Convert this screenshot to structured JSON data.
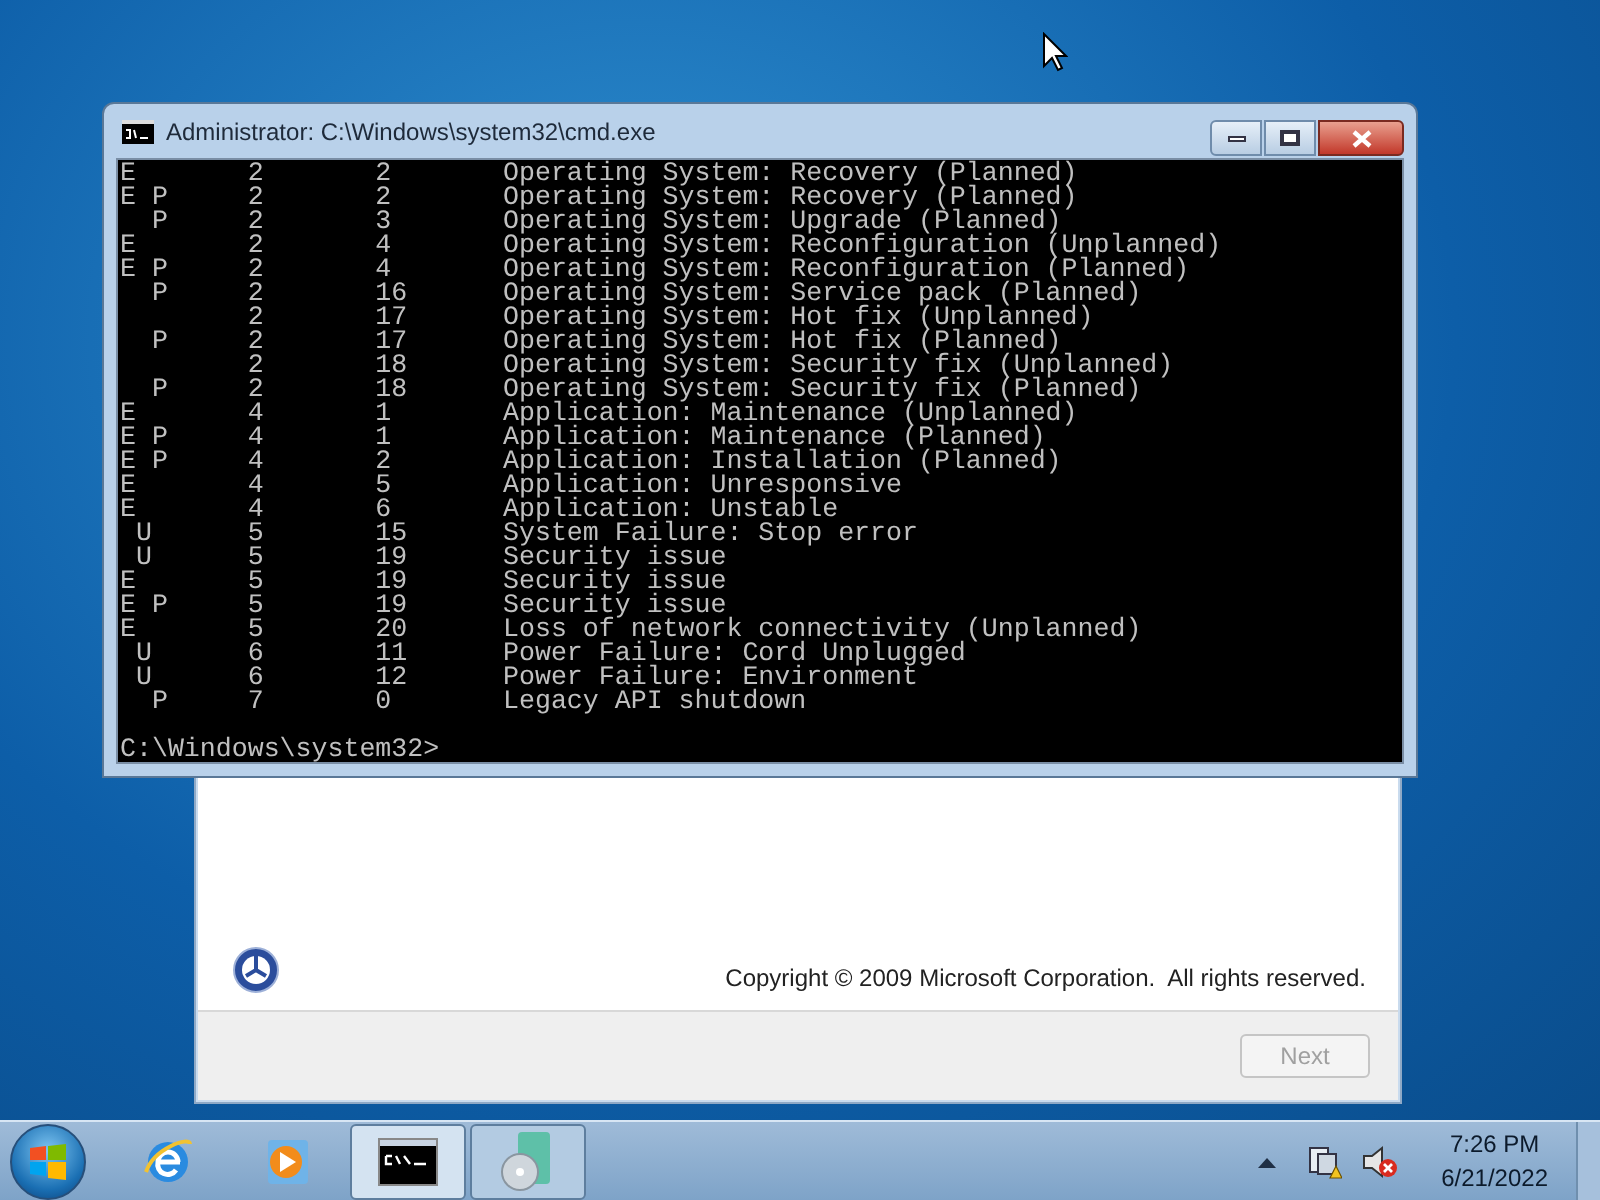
{
  "console": {
    "title": "Administrator: C:\\Windows\\system32\\cmd.exe",
    "lines": [
      "E       2       2       Operating System: Recovery (Planned)",
      "E P     2       2       Operating System: Recovery (Planned)",
      "  P     2       3       Operating System: Upgrade (Planned)",
      "E       2       4       Operating System: Reconfiguration (Unplanned)",
      "E P     2       4       Operating System: Reconfiguration (Planned)",
      "  P     2       16      Operating System: Service pack (Planned)",
      "        2       17      Operating System: Hot fix (Unplanned)",
      "  P     2       17      Operating System: Hot fix (Planned)",
      "        2       18      Operating System: Security fix (Unplanned)",
      "  P     2       18      Operating System: Security fix (Planned)",
      "E       4       1       Application: Maintenance (Unplanned)",
      "E P     4       1       Application: Maintenance (Planned)",
      "E P     4       2       Application: Installation (Planned)",
      "E       4       5       Application: Unresponsive",
      "E       4       6       Application: Unstable",
      " U      5       15      System Failure: Stop error",
      " U      5       19      Security issue",
      "E       5       19      Security issue",
      "E P     5       19      Security issue",
      "E       5       20      Loss of network connectivity (Unplanned)",
      " U      6       11      Power Failure: Cord Unplugged",
      " U      6       12      Power Failure: Environment",
      "  P     7       0       Legacy API shutdown"
    ],
    "prompt": "C:\\Windows\\system32>"
  },
  "setup": {
    "copyright": "Copyright © 2009 Microsoft Corporation.  All rights reserved.",
    "next_button": {
      "label": "Next",
      "disabled": true
    }
  },
  "taskbar": {
    "items": [
      {
        "kind": "browser",
        "running": false,
        "selected": false
      },
      {
        "kind": "media",
        "running": false,
        "selected": false
      },
      {
        "kind": "terminal",
        "running": true,
        "selected": true
      },
      {
        "kind": "setup",
        "running": true,
        "selected": false
      }
    ],
    "clock": {
      "time": "7:26 PM",
      "date": "6/21/2022"
    }
  }
}
